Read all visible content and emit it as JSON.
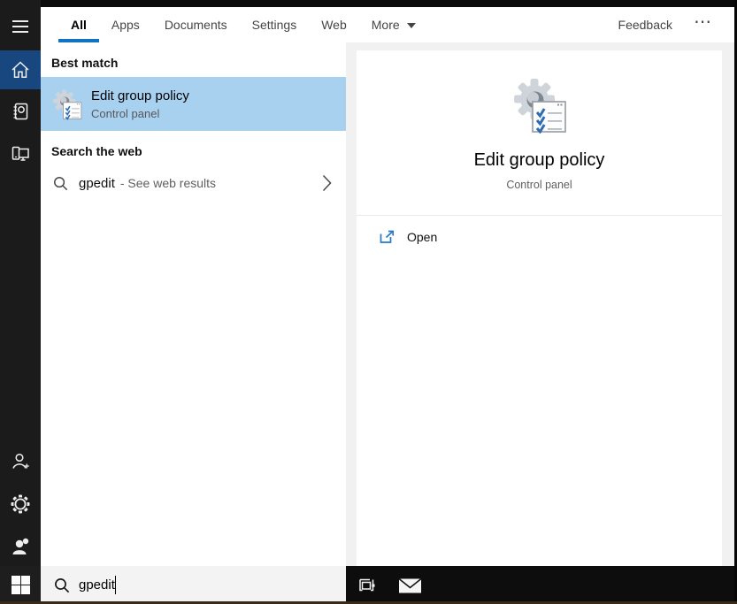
{
  "tabs": {
    "items": [
      {
        "label": "All"
      },
      {
        "label": "Apps"
      },
      {
        "label": "Documents"
      },
      {
        "label": "Settings"
      },
      {
        "label": "Web"
      },
      {
        "label": "More"
      }
    ],
    "active_index": 0,
    "feedback_label": "Feedback",
    "ellipsis": "⋯"
  },
  "sidebar": {
    "icons": [
      "hamburger-menu",
      "home",
      "notebook",
      "devices",
      "add-account",
      "settings-gear",
      "feedback-person"
    ],
    "selected": "home"
  },
  "results": {
    "best_match_header": "Best match",
    "best_match": {
      "title": "Edit group policy",
      "subtitle": "Control panel",
      "icon": "group-policy-icon"
    },
    "web_header": "Search the web",
    "web_result": {
      "query": "gpedit",
      "annotation": "- See web results",
      "icon": "search-icon"
    }
  },
  "preview": {
    "title": "Edit group policy",
    "subtitle": "Control panel",
    "icon": "group-policy-icon",
    "actions": [
      {
        "label": "Open",
        "icon": "open-external-icon"
      }
    ]
  },
  "taskbar": {
    "search": {
      "value": "gpedit",
      "placeholder": ""
    },
    "icons": [
      "start-button",
      "task-view",
      "mail"
    ]
  },
  "colors": {
    "accent_blue": "#1273c4",
    "selection_blue": "#a8d1f0",
    "sidebar_selected_blue": "#17477e",
    "check_blue": "#2e6db5",
    "open_icon_blue": "#2679c4"
  }
}
